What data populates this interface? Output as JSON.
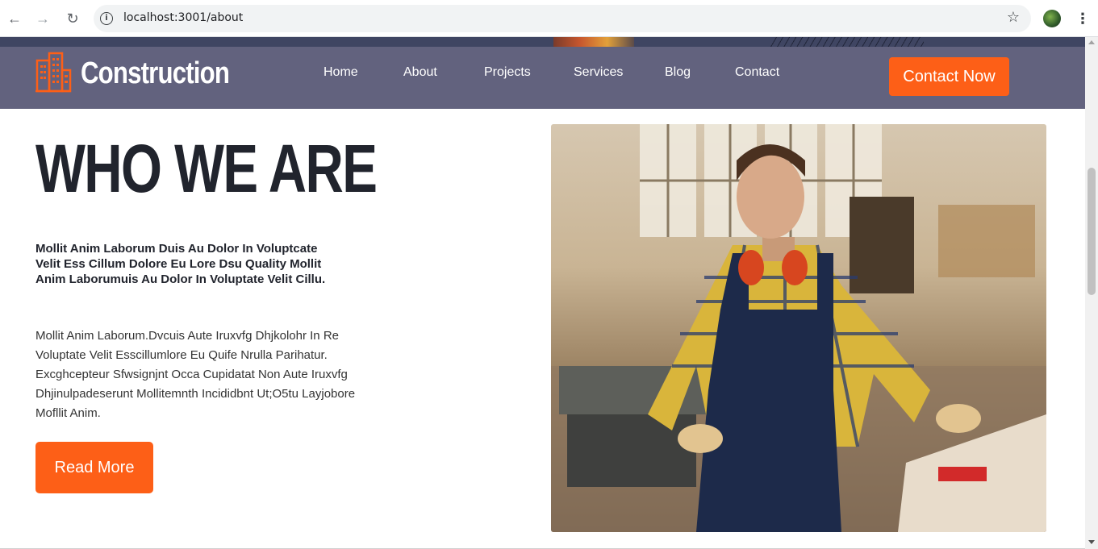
{
  "browser": {
    "url": "localhost:3001/about",
    "icons": [
      "back-icon",
      "forward-icon",
      "reload-icon",
      "info-icon",
      "star-icon",
      "profile-avatar",
      "kebab-menu-icon"
    ]
  },
  "header": {
    "brand": "Construction",
    "nav": [
      "Home",
      "About",
      "Projects",
      "Services",
      "Blog",
      "Contact"
    ],
    "cta": "Contact Now"
  },
  "about": {
    "title": "WHO WE ARE",
    "lead": "Mollit Anim Laborum Duis Au Dolor In Voluptcate Velit Ess Cillum Dolore Eu Lore Dsu Quality Mollit Anim Laborumuis Au Dolor In Voluptate Velit Cillu.",
    "body": "Mollit Anim Laborum.Dvcuis Aute Iruxvfg Dhjkolohr In Re Voluptate Velit Esscillumlore Eu Quife Nrulla Parihatur. Excghcepteur Sfwsignjnt Occa Cupidatat Non Aute Iruxvfg Dhjinulpadeserunt Mollitemnth Incididbnt Ut;O5tu Layjobore Mofllit Anim.",
    "button": "Read More"
  },
  "colors": {
    "accent": "#fd5f17",
    "navbar": "#62627e",
    "heading": "#21242d"
  }
}
